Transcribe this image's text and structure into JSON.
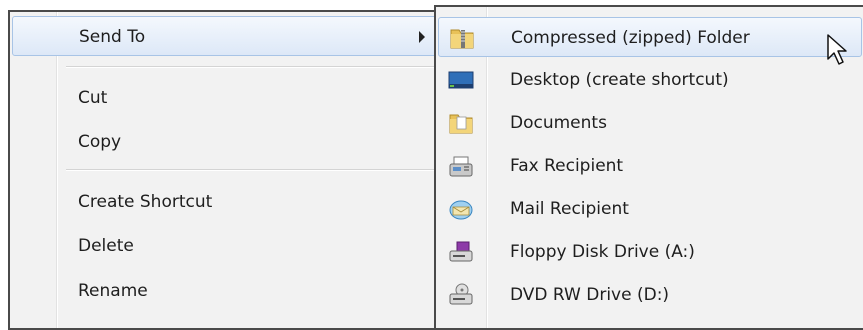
{
  "main_menu": {
    "send_to": "Send To",
    "cut": "Cut",
    "copy": "Copy",
    "create_shortcut": "Create Shortcut",
    "delete": "Delete",
    "rename": "Rename"
  },
  "send_to_menu": {
    "items": [
      {
        "label": "Compressed (zipped) Folder",
        "icon": "zip-folder-icon"
      },
      {
        "label": "Desktop (create shortcut)",
        "icon": "desktop-icon"
      },
      {
        "label": "Documents",
        "icon": "documents-folder-icon"
      },
      {
        "label": "Fax Recipient",
        "icon": "fax-icon"
      },
      {
        "label": "Mail Recipient",
        "icon": "mail-icon"
      },
      {
        "label": "Floppy Disk Drive (A:)",
        "icon": "floppy-drive-icon"
      },
      {
        "label": "DVD RW Drive (D:)",
        "icon": "dvd-drive-icon"
      }
    ]
  }
}
